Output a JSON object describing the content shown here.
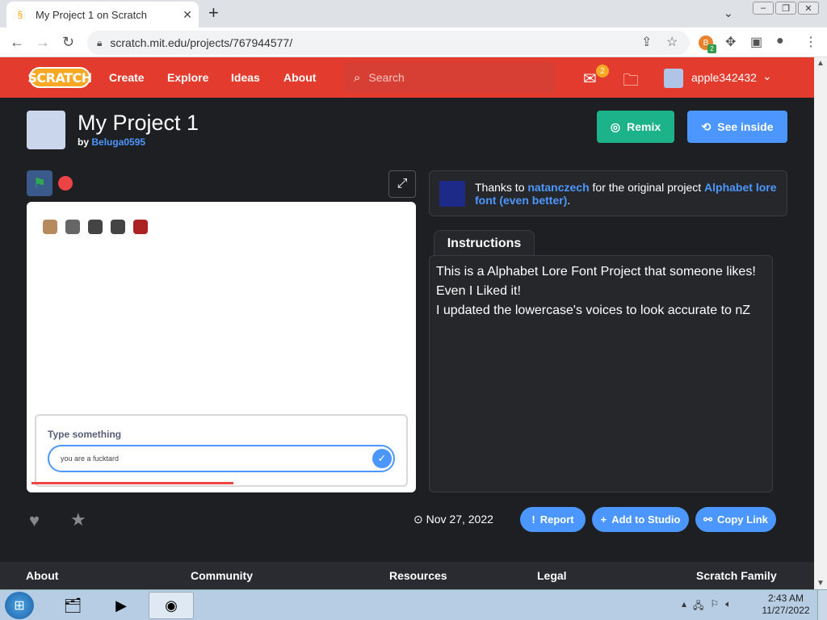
{
  "browser": {
    "tab_title": "My Project 1 on Scratch",
    "tab_close": "✕",
    "new_tab": "+",
    "url": "scratch.mit.edu/projects/767944577/",
    "extension_badge": "2"
  },
  "header": {
    "logo_text": "SCRATCH",
    "nav": [
      "Create",
      "Explore",
      "Ideas",
      "About"
    ],
    "search_placeholder": "Search",
    "mail_count": "2",
    "username": "apple342432"
  },
  "project": {
    "title": "My Project 1",
    "by_label": "by",
    "author": "Beluga0595",
    "remix_label": "Remix",
    "see_inside_label": "See inside"
  },
  "stage": {
    "ask_label": "Type something",
    "ask_value": "you are a fucktard"
  },
  "credits": {
    "prefix": "Thanks to",
    "user": "natanczech",
    "middle": "for the original project",
    "project": "Alphabet lore font (even better)",
    "suffix": "."
  },
  "instructions": {
    "tab_label": "Instructions",
    "lines": [
      "This is a Alphabet Lore Font Project that someone likes!",
      "Even I Liked it!",
      "I updated the lowercase's voices to look accurate to nZ"
    ]
  },
  "actions": {
    "date": "Nov 27, 2022",
    "report_label": "Report",
    "add_studio_label": "Add to Studio",
    "copy_link_label": "Copy Link"
  },
  "footer": [
    "About",
    "Community",
    "Resources",
    "Legal",
    "Scratch Family"
  ],
  "taskbar": {
    "time": "2:43 AM",
    "date": "11/27/2022"
  }
}
